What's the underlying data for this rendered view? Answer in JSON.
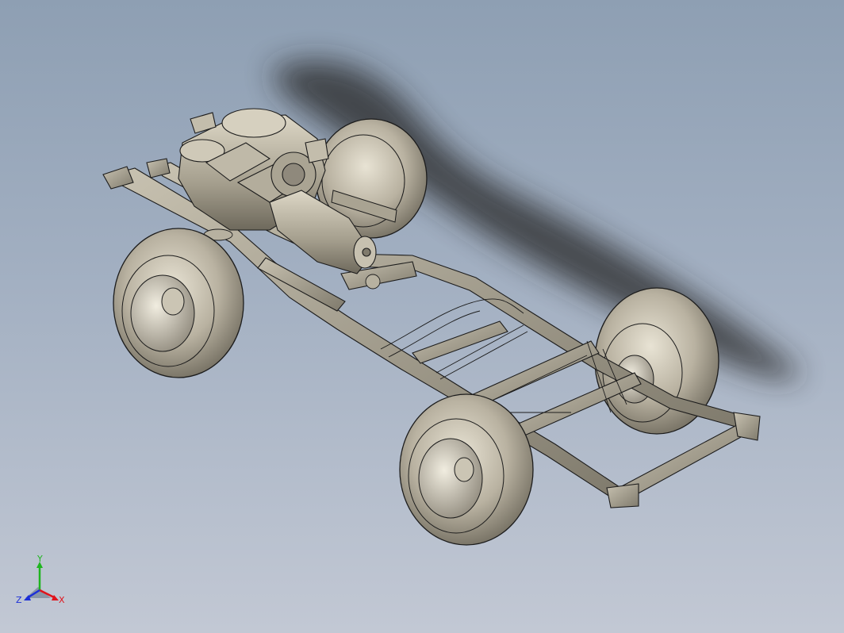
{
  "viewport": {
    "background_top": "#8e9fb3",
    "background_bottom": "#c2c8d4"
  },
  "model": {
    "body_color": "#a39e8e",
    "tire_color": "#b8b1a0",
    "edge_color": "#1c1c1c",
    "shadow_color": "#2a2a2a"
  },
  "triad": {
    "x_label": "X",
    "y_label": "Y",
    "z_label": "Z",
    "x_color": "#e0141c",
    "y_color": "#1fb51f",
    "z_color": "#1c2fd8"
  }
}
